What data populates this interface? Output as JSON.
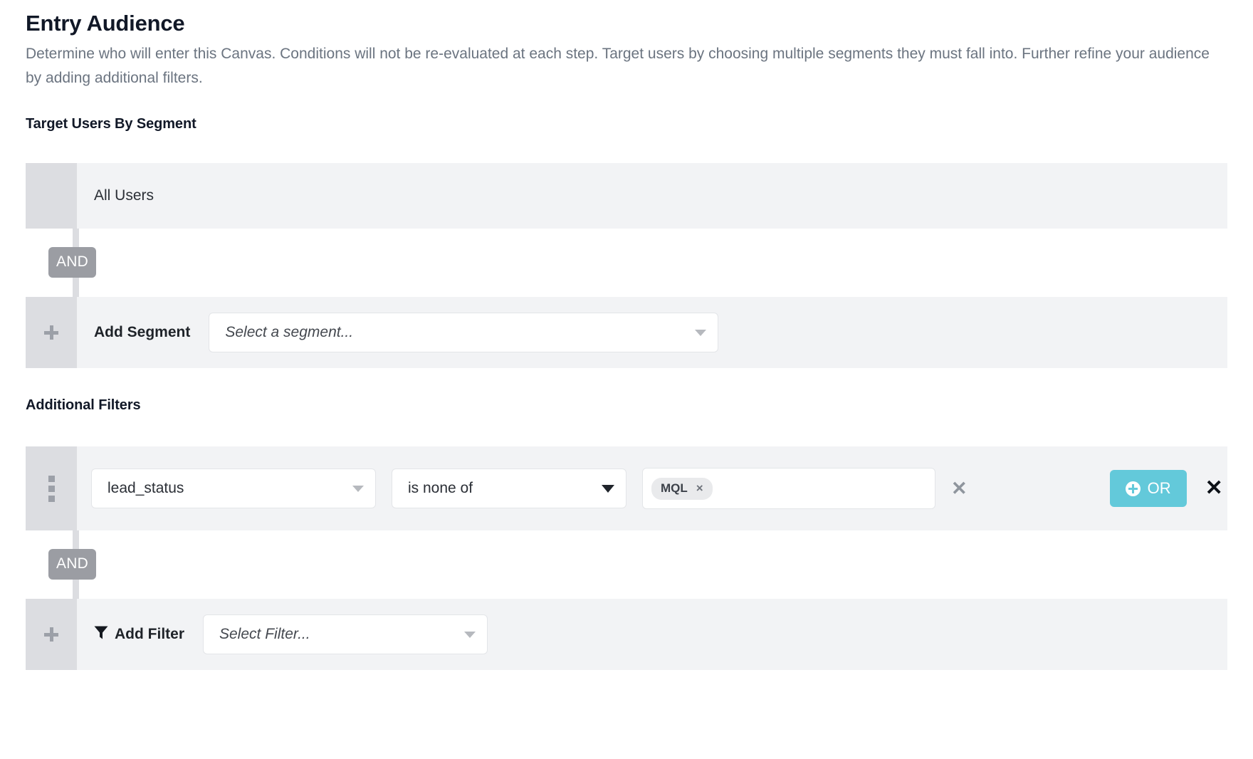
{
  "header": {
    "title": "Entry Audience",
    "description": "Determine who will enter this Canvas. Conditions will not be re-evaluated at each step. Target users by choosing multiple segments they must fall into. Further refine your audience by adding additional filters."
  },
  "segments": {
    "heading": "Target Users By Segment",
    "all_users_label": "All Users",
    "and_label": "AND",
    "add_segment_label": "Add Segment",
    "segment_placeholder": "Select a segment..."
  },
  "filters": {
    "heading": "Additional Filters",
    "and_label": "AND",
    "row": {
      "field_value": "lead_status",
      "operator_value": "is none of",
      "tags": [
        {
          "label": "MQL",
          "remove_label": "×"
        }
      ],
      "clear_label": "✕",
      "or_label": "OR",
      "delete_label": "✕"
    },
    "add_filter_label": "Add Filter",
    "filter_placeholder": "Select Filter..."
  },
  "colors": {
    "accent_teal": "#63c9da",
    "row_bg": "#f2f3f5",
    "handle_bg": "#dcdde1",
    "and_badge_bg": "#9b9da3"
  }
}
